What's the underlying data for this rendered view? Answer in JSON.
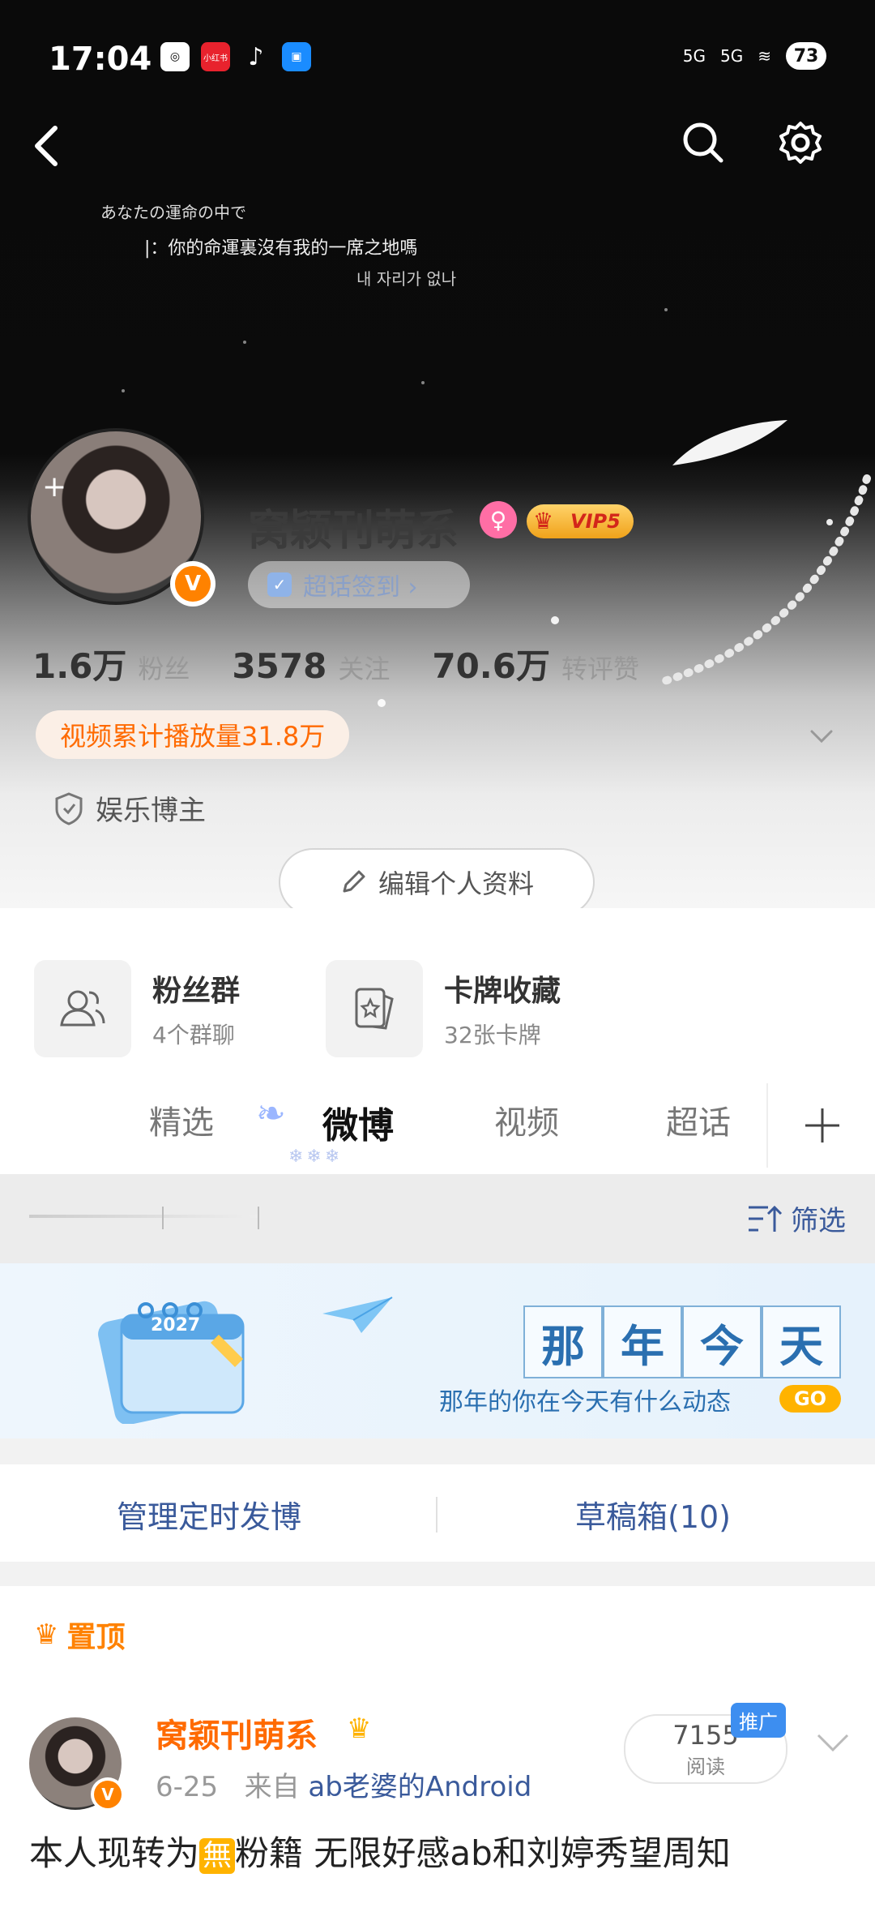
{
  "status": {
    "time": "17:04",
    "app_icon_labels": [
      "小红书"
    ],
    "signal_1": "5G",
    "signal_2": "5G",
    "battery": "73"
  },
  "cover": {
    "line1": "あなたの運命の中で",
    "line2": "|：你的命運裏沒有我的一席之地嗎",
    "line3": "내 자리가 없나"
  },
  "profile": {
    "name": "窝颖刊萌系",
    "vip_label": "VIP5",
    "checkin_label": "超话签到 ›",
    "stats": [
      {
        "num": "1.6万",
        "label": "粉丝"
      },
      {
        "num": "3578",
        "label": "关注"
      },
      {
        "num": "70.6万",
        "label": "转评赞"
      }
    ],
    "video_plays": "视频累计播放量31.8万",
    "blogger_tag": "娱乐博主",
    "edit_label": "编辑个人资料"
  },
  "quick_entries": [
    {
      "title": "粉丝群",
      "sub": "4个群聊"
    },
    {
      "title": "卡牌收藏",
      "sub": "32张卡牌"
    }
  ],
  "tabs": [
    {
      "label": "精选"
    },
    {
      "label": "微博"
    },
    {
      "label": "视频"
    },
    {
      "label": "超话"
    }
  ],
  "tab_decoration": "❄❄❄",
  "filter": {
    "label": "筛选"
  },
  "banner": {
    "calendar_year": "2027",
    "chars": [
      "那",
      "年",
      "今",
      "天"
    ],
    "subtitle": "那年的你在今天有什么动态",
    "go": "GO"
  },
  "manage": {
    "scheduled": "管理定时发博",
    "drafts": "草稿箱(10)"
  },
  "post": {
    "pinned_label": "置顶",
    "author": "窝颖刊萌系",
    "date": "6-25",
    "from_prefix": "来自",
    "source": "ab老婆的Android",
    "reads": "7155",
    "reads_label": "阅读",
    "promo": "推广",
    "text_before": "本人现转为",
    "text_badge": "無",
    "text_after": "粉籍 无限好感ab和刘婷秀望周知"
  },
  "colors": {
    "accent_orange": "#ff8200",
    "link_blue": "#3a5a9b"
  }
}
